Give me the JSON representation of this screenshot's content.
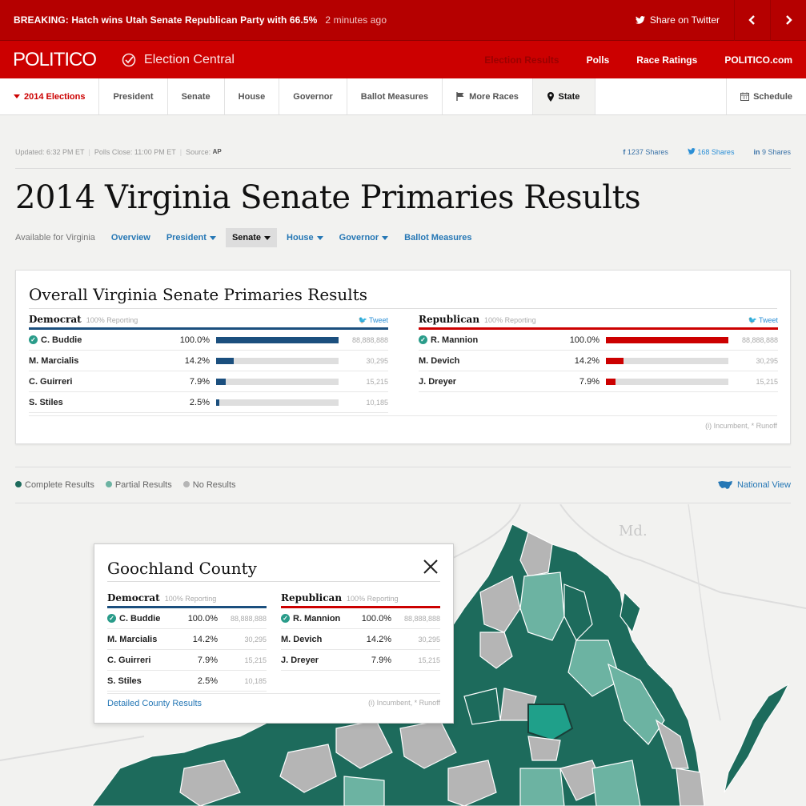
{
  "breaking": {
    "label": "BREAKING: Hatch wins Utah Senate Republican Party with 66.5%",
    "time": "2 minutes ago",
    "share": "Share on Twitter"
  },
  "topnav": {
    "logo": "POLITICO",
    "section": "Election Central",
    "links": [
      "Election Results",
      "Polls",
      "Race Ratings",
      "POLITICO.com"
    ]
  },
  "secnav": {
    "items": [
      "2014 Elections",
      "President",
      "Senate",
      "House",
      "Governor",
      "Ballot Measures",
      "More Races",
      "State"
    ],
    "schedule": "Schedule"
  },
  "meta": {
    "updated": "Updated: 6:32 PM ET",
    "polls": "Polls Close: 11:00 PM ET",
    "source": "Source:",
    "source_logo": "AP",
    "shares_fb": "1237 Shares",
    "shares_tw": "168 Shares",
    "shares_in": "9 Shares"
  },
  "title": "2014 Virginia Senate Primaries Results",
  "subnav": {
    "available": "Available for Virginia",
    "items": [
      "Overview",
      "President",
      "Senate",
      "House",
      "Governor",
      "Ballot Measures"
    ]
  },
  "overall": {
    "title": "Overall Virginia Senate Primaries Results",
    "note": "(i) Incumbent, * Runoff",
    "dem": {
      "party": "Democrat",
      "reporting": "100% Reporting",
      "tweet": "Tweet",
      "rows": [
        {
          "name": "C. Buddie",
          "pct": "100.0%",
          "votes": "88,888,888",
          "share": 1.0,
          "winner": true
        },
        {
          "name": "M. Marcialis",
          "pct": "14.2%",
          "votes": "30,295",
          "share": 0.142
        },
        {
          "name": "C. Guirreri",
          "pct": "7.9%",
          "votes": "15,215",
          "share": 0.079
        },
        {
          "name": "S. Stiles",
          "pct": "2.5%",
          "votes": "10,185",
          "share": 0.025
        }
      ]
    },
    "rep": {
      "party": "Republican",
      "reporting": "100% Reporting",
      "tweet": "Tweet",
      "rows": [
        {
          "name": "R. Mannion",
          "pct": "100.0%",
          "votes": "88,888,888",
          "share": 1.0,
          "winner": true
        },
        {
          "name": "M. Devich",
          "pct": "14.2%",
          "votes": "30,295",
          "share": 0.142
        },
        {
          "name": "J. Dreyer",
          "pct": "7.9%",
          "votes": "15,215",
          "share": 0.079
        }
      ]
    }
  },
  "legend": {
    "complete": "Complete Results",
    "partial": "Partial Results",
    "none": "No Results",
    "national": "National View",
    "colors": {
      "complete": "#1d6b5c",
      "partial": "#6cb3a2",
      "none": "#b5b5b5"
    }
  },
  "map": {
    "state_label": "Md."
  },
  "popup": {
    "title": "Goochland County",
    "detail_link": "Detailed County Results",
    "note": "(i) Incumbent, * Runoff",
    "dem": {
      "party": "Democrat",
      "reporting": "100% Reporting",
      "rows": [
        {
          "name": "C. Buddie",
          "pct": "100.0%",
          "votes": "88,888,888",
          "winner": true
        },
        {
          "name": "M. Marcialis",
          "pct": "14.2%",
          "votes": "30,295"
        },
        {
          "name": "C. Guirreri",
          "pct": "7.9%",
          "votes": "15,215"
        },
        {
          "name": "S. Stiles",
          "pct": "2.5%",
          "votes": "10,185"
        }
      ]
    },
    "rep": {
      "party": "Republican",
      "reporting": "100% Reporting",
      "rows": [
        {
          "name": "R. Mannion",
          "pct": "100.0%",
          "votes": "88,888,888",
          "winner": true
        },
        {
          "name": "M. Devich",
          "pct": "14.2%",
          "votes": "30,295"
        },
        {
          "name": "J. Dreyer",
          "pct": "7.9%",
          "votes": "15,215"
        }
      ]
    }
  }
}
